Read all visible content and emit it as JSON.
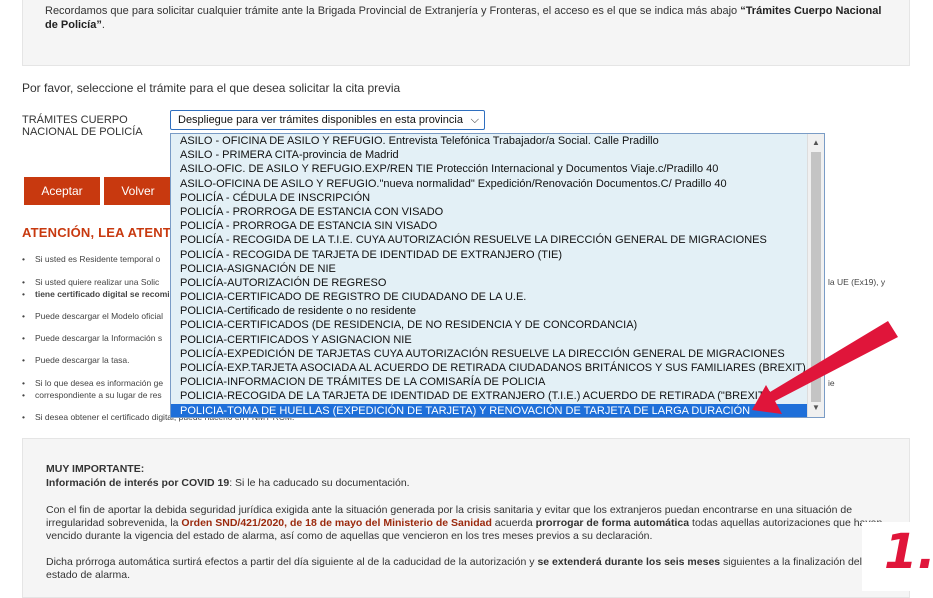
{
  "notice": {
    "text_pre": "Recordamos que para solicitar cualquier trámite ante la Brigada Provincial de Extranjería y Fronteras, el acceso es el que se indica más abajo ",
    "text_bold": "“Trámites Cuerpo Nacional de Policía”",
    "text_post": "."
  },
  "prompt": "Por favor, seleccione el trámite para el que desea solicitar la cita previa",
  "tramites_label": "TRÁMITES CUERPO NACIONAL DE POLICÍA",
  "select": {
    "value": "Despliegue para ver trámites disponibles en esta provincia",
    "options": [
      "ASILO - OFICINA DE ASILO Y REFUGIO. Entrevista Telefónica Trabajador/a Social. Calle Pradillo",
      "ASILO - PRIMERA CITA-provincia de Madrid",
      "ASILO-OFIC. DE ASILO Y REFUGIO.EXP/REN TIE Protección Internacional y Documentos Viaje.c/Pradillo 40",
      "ASILO-OFICINA DE ASILO Y REFUGIO.\"nueva normalidad\" Expedición/Renovación Documentos.C/ Pradillo 40",
      "POLICÍA - CÉDULA DE INSCRIPCIÓN",
      "POLICÍA - PRORROGA DE ESTANCIA CON VISADO",
      "POLICÍA - PRORROGA DE ESTANCIA SIN VISADO",
      "POLICÍA - RECOGIDA DE LA T.I.E. CUYA AUTORIZACIÓN RESUELVE LA DIRECCIÓN GENERAL DE MIGRACIONES",
      "POLICÍA - RECOGIDA DE TARJETA DE IDENTIDAD DE EXTRANJERO (TIE)",
      "POLICIA-ASIGNACIÓN DE NIE",
      "POLICÍA-AUTORIZACIÓN DE REGRESO",
      "POLICIA-CERTIFICADO DE REGISTRO DE CIUDADANO DE LA U.E.",
      "POLICIA-Certificado de residente o no residente",
      "POLICIA-CERTIFICADOS (DE RESIDENCIA, DE NO RESIDENCIA Y DE CONCORDANCIA)",
      "POLICIA-CERTIFICADOS Y ASIGNACION NIE",
      "POLICÍA-EXPEDICIÓN DE TARJETAS CUYA AUTORIZACIÓN RESUELVE LA DIRECCIÓN GENERAL DE MIGRACIONES",
      "POLICÍA-EXP.TARJETA ASOCIADA AL ACUERDO DE RETIRADA CIUDADANOS BRITÁNICOS Y SUS FAMILIARES (BREXIT)",
      "POLICIA-INFORMACION DE TRÁMITES DE LA COMISARÍA DE POLICIA",
      "POLICIA-RECOGIDA DE LA TARJETA DE IDENTIDAD DE EXTRANJERO (T.I.E.) ACUERDO DE RETIRADA (\"BREXIT\")",
      "POLICIA-TOMA DE HUELLAS (EXPEDICIÓN DE TARJETA) Y RENOVACIÓN DE TARJETA DE LARGA DURACIÓN"
    ],
    "selected_index": 19
  },
  "buttons": {
    "accept": "Aceptar",
    "back": "Volver"
  },
  "attention_heading": "ATENCIÓN, LEA ATENT",
  "bullets": [
    "Si usted es Residente temporal o",
    "Si usted quiere realizar una Solic",
    "tiene certificado digital se recomi",
    "Puede descargar el Modelo oficial",
    "Puede descargar la Información s",
    "Puede descargar la tasa.",
    "Si lo que desea es información ge",
    "correspondiente a su lugar de res",
    "Si desea obtener el certificado digital, puede hacerlo en FNMT-RCM."
  ],
  "right_notes": [
    "la UE (Ex19), y",
    "ie"
  ],
  "important": {
    "title": "MUY IMPORTANTE:",
    "covid_bold": "Información de interés por COVID 19",
    "covid_text": ": Si le ha caducado su documentación.",
    "p1_a": "Con el fin de aportar la debida seguridad jurídica exigida ante la situación generada por la crisis sanitaria y evitar que los extranjeros puedan encontrarse en una situación de irregularidad sobrevenida, la ",
    "p1_red": "Orden SND/421/2020, de 18 de mayo del Ministerio de Sanidad",
    "p1_b": " acuerda ",
    "p1_bold": "prorrogar de forma automática",
    "p1_c": " todas aquellas autorizaciones que havan vencido durante la vigencia del estado de alarma, así como de aquellas que vencieron en los tres meses previos a su declaración.",
    "p2_a": "Dicha prórroga automática surtirá efectos a partir del día siguiente al de la caducidad de la autorización y ",
    "p2_bold": "se extenderá durante los seis meses",
    "p2_b": " siguientes a la finalización del estado de alarma."
  },
  "step_badge": "1.",
  "colors": {
    "accent": "#c8390f",
    "selection": "#1e6fd9",
    "annotation": "#e0153a",
    "list_bg": "#e3f0f6"
  }
}
